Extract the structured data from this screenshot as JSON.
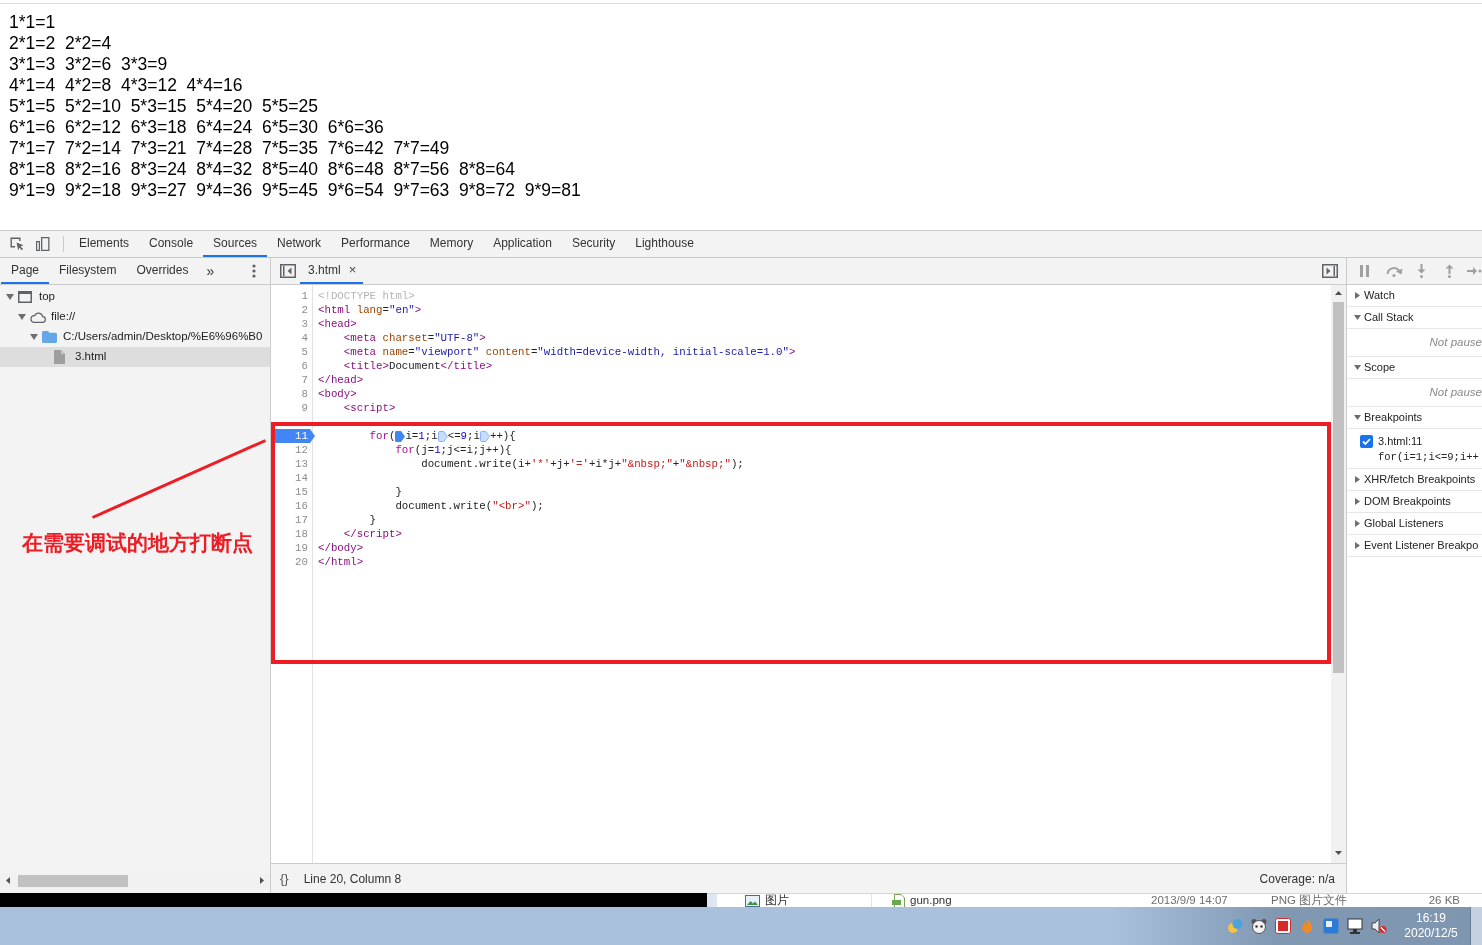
{
  "page_output": {
    "lines": [
      "1*1=1",
      "2*1=2  2*2=4",
      "3*1=3  3*2=6  3*3=9",
      "4*1=4  4*2=8  4*3=12  4*4=16",
      "5*1=5  5*2=10  5*3=15  5*4=20  5*5=25",
      "6*1=6  6*2=12  6*3=18  6*4=24  6*5=30  6*6=36",
      "7*1=7  7*2=14  7*3=21  7*4=28  7*5=35  7*6=42  7*7=49",
      "8*1=8  8*2=16  8*3=24  8*4=32  8*5=40  8*6=48  8*7=56  8*8=64",
      "9*1=9  9*2=18  9*3=27  9*4=36  9*5=45  9*6=54  9*7=63  9*8=72  9*9=81"
    ]
  },
  "devtools": {
    "tabs": [
      {
        "label": "Elements",
        "selected": false
      },
      {
        "label": "Console",
        "selected": false
      },
      {
        "label": "Sources",
        "selected": true
      },
      {
        "label": "Network",
        "selected": false
      },
      {
        "label": "Performance",
        "selected": false
      },
      {
        "label": "Memory",
        "selected": false
      },
      {
        "label": "Application",
        "selected": false
      },
      {
        "label": "Security",
        "selected": false
      },
      {
        "label": "Lighthouse",
        "selected": false
      }
    ],
    "navigator": {
      "tabs": [
        {
          "label": "Page",
          "selected": true
        },
        {
          "label": "Filesystem",
          "selected": false
        },
        {
          "label": "Overrides",
          "selected": false
        }
      ],
      "more_tabs": "»",
      "tree": [
        {
          "kind": "frame",
          "label": "top",
          "expanded": true,
          "selected": false,
          "children": [
            {
              "kind": "origin",
              "label": "file://",
              "expanded": true,
              "selected": false,
              "children": [
                {
                  "kind": "folder",
                  "label": "C:/Users/admin/Desktop/%E6%96%B0",
                  "expanded": true,
                  "selected": false,
                  "children": [
                    {
                      "kind": "file",
                      "label": "3.html",
                      "selected": true
                    }
                  ]
                }
              ]
            }
          ]
        }
      ]
    },
    "editor": {
      "tabs": [
        {
          "label": "3.html",
          "selected": true,
          "close": "×"
        }
      ],
      "lines": [
        {
          "number": "1",
          "breakpoint": false,
          "code": [
            {
              "kind": "doctype",
              "text": "<!DOCTYPE html>"
            }
          ]
        },
        {
          "number": "2",
          "breakpoint": false,
          "code": [
            {
              "kind": "tag",
              "text": "<html"
            },
            {
              "kind": "attr",
              "text": " lang"
            },
            {
              "kind": "plain",
              "text": "="
            },
            {
              "kind": "value",
              "text": "\"en\""
            },
            {
              "kind": "tag",
              "text": ">"
            }
          ]
        },
        {
          "number": "3",
          "breakpoint": false,
          "code": [
            {
              "kind": "tag",
              "text": "<head>"
            }
          ]
        },
        {
          "number": "4",
          "breakpoint": false,
          "code": [
            {
              "kind": "tag",
              "text": "    <meta"
            },
            {
              "kind": "attr",
              "text": " charset"
            },
            {
              "kind": "plain",
              "text": "="
            },
            {
              "kind": "value",
              "text": "\"UTF-8\""
            },
            {
              "kind": "tag",
              "text": ">"
            }
          ]
        },
        {
          "number": "5",
          "breakpoint": false,
          "code": [
            {
              "kind": "tag",
              "text": "    <meta"
            },
            {
              "kind": "attr",
              "text": " name"
            },
            {
              "kind": "plain",
              "text": "="
            },
            {
              "kind": "value",
              "text": "\"viewport\""
            },
            {
              "kind": "attr",
              "text": " content"
            },
            {
              "kind": "plain",
              "text": "="
            },
            {
              "kind": "value",
              "text": "\"width=device-width, initial-scale=1.0\""
            },
            {
              "kind": "tag",
              "text": ">"
            }
          ]
        },
        {
          "number": "6",
          "breakpoint": false,
          "code": [
            {
              "kind": "tag",
              "text": "    <title>"
            },
            {
              "kind": "plain",
              "text": "Document"
            },
            {
              "kind": "tag",
              "text": "</title>"
            }
          ]
        },
        {
          "number": "7",
          "breakpoint": false,
          "code": [
            {
              "kind": "tag",
              "text": "</head>"
            }
          ]
        },
        {
          "number": "8",
          "breakpoint": false,
          "code": [
            {
              "kind": "tag",
              "text": "<body>"
            }
          ]
        },
        {
          "number": "9",
          "breakpoint": false,
          "code": [
            {
              "kind": "tag",
              "text": "    <script>"
            }
          ]
        }
      ],
      "framed_lines": [
        {
          "number": "11",
          "breakpoint": true,
          "code": [
            {
              "kind": "keyword",
              "text": "        for"
            },
            {
              "kind": "plain",
              "text": "("
            },
            {
              "kind": "marker",
              "active": true
            },
            {
              "kind": "plain",
              "text": "i="
            },
            {
              "kind": "number",
              "text": "1"
            },
            {
              "kind": "plain",
              "text": ";i"
            },
            {
              "kind": "marker",
              "active": false
            },
            {
              "kind": "plain",
              "text": "<="
            },
            {
              "kind": "number",
              "text": "9"
            },
            {
              "kind": "plain",
              "text": ";i"
            },
            {
              "kind": "marker",
              "active": false
            },
            {
              "kind": "plain",
              "text": "++){"
            }
          ]
        },
        {
          "number": "12",
          "breakpoint": false,
          "code": [
            {
              "kind": "keyword",
              "text": "            for"
            },
            {
              "kind": "plain",
              "text": "(j="
            },
            {
              "kind": "number",
              "text": "1"
            },
            {
              "kind": "plain",
              "text": ";j<=i;j++){"
            }
          ]
        },
        {
          "number": "13",
          "breakpoint": false,
          "code": [
            {
              "kind": "plain",
              "text": "                document.write(i+"
            },
            {
              "kind": "string",
              "text": "'*'"
            },
            {
              "kind": "plain",
              "text": "+j+"
            },
            {
              "kind": "string",
              "text": "'='"
            },
            {
              "kind": "plain",
              "text": "+i*j+"
            },
            {
              "kind": "string",
              "text": "\"&nbsp;\""
            },
            {
              "kind": "plain",
              "text": "+"
            },
            {
              "kind": "string",
              "text": "\"&nbsp;\""
            },
            {
              "kind": "plain",
              "text": ");"
            }
          ]
        },
        {
          "number": "14",
          "breakpoint": false
        },
        {
          "number": "15",
          "breakpoint": false,
          "code": [
            {
              "kind": "plain",
              "text": "            }"
            }
          ]
        },
        {
          "number": "16",
          "breakpoint": false,
          "code": [
            {
              "kind": "plain",
              "text": "            document.write("
            },
            {
              "kind": "string",
              "text": "\"<br>\""
            },
            {
              "kind": "plain",
              "text": ");"
            }
          ]
        },
        {
          "number": "17",
          "breakpoint": false,
          "code": [
            {
              "kind": "plain",
              "text": "        }"
            }
          ]
        },
        {
          "number": "18",
          "breakpoint": false,
          "code": [
            {
              "kind": "tag",
              "text": "    </script>"
            }
          ]
        },
        {
          "number": "19",
          "breakpoint": false,
          "code": [
            {
              "kind": "tag",
              "text": "</body>"
            }
          ]
        },
        {
          "number": "20",
          "breakpoint": false,
          "code": [
            {
              "kind": "tag",
              "text": "</html>"
            }
          ]
        }
      ],
      "status": {
        "format_button": "{}",
        "position": "Line 20, Column 8",
        "coverage": "Coverage: n/a"
      }
    },
    "debugger": {
      "sections": [
        {
          "title": "Watch",
          "expanded": false
        },
        {
          "title": "Call Stack",
          "expanded": true,
          "message": "Not pause"
        },
        {
          "title": "Scope",
          "expanded": true,
          "message": "Not pause"
        },
        {
          "title": "Breakpoints",
          "expanded": true,
          "breakpoints": [
            {
              "location": "3.html:11",
              "code": "for(i=1;i<=9;i++",
              "checked": true
            }
          ]
        },
        {
          "title": "XHR/fetch Breakpoints",
          "expanded": false
        },
        {
          "title": "DOM Breakpoints",
          "expanded": false
        },
        {
          "title": "Global Listeners",
          "expanded": false
        },
        {
          "title": "Event Listener Breakpo",
          "expanded": false
        }
      ]
    }
  },
  "annotation": {
    "text": "在需要调试的地方打断点"
  },
  "background_window": {
    "nav_item": "图片",
    "file": {
      "name": "gun.png",
      "modified": "2013/9/9 14:07",
      "type": "PNG 图片文件",
      "size": "26 KB"
    }
  },
  "taskbar": {
    "time": "16:19",
    "date": "2020/12/5"
  }
}
